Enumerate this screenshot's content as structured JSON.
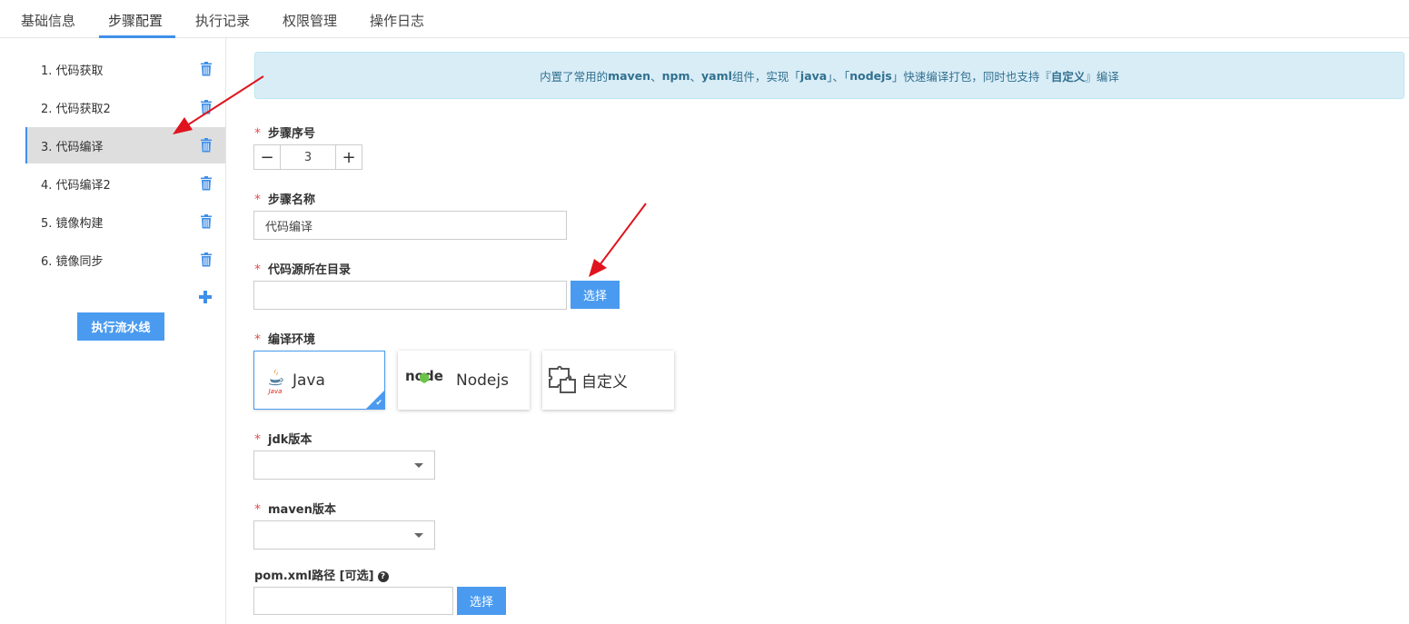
{
  "tabs": [
    {
      "label": "基础信息"
    },
    {
      "label": "步骤配置"
    },
    {
      "label": "执行记录"
    },
    {
      "label": "权限管理"
    },
    {
      "label": "操作日志"
    }
  ],
  "sidebar": {
    "steps": [
      {
        "label": "1. 代码获取"
      },
      {
        "label": "2. 代码获取2"
      },
      {
        "label": "3. 代码编译"
      },
      {
        "label": "4. 代码编译2"
      },
      {
        "label": "5. 镜像构建"
      },
      {
        "label": "6. 镜像同步"
      }
    ],
    "run_button": "执行流水线"
  },
  "notice": {
    "p1": "内置了常用的",
    "b1": "maven",
    "p2": "、",
    "b2": "npm",
    "p3": "、",
    "b3": "yaml",
    "p4": "组件，实现「",
    "b4": "java",
    "p5": "」、「",
    "b5": "nodejs",
    "p6": "」快速编译打包，同时也支持『",
    "b6": "自定义",
    "p7": "』编译"
  },
  "form": {
    "required_mark": "*",
    "step_no": {
      "label": "步骤序号",
      "value": "3",
      "minus": "−",
      "plus": "+"
    },
    "step_name": {
      "label": "步骤名称",
      "value": "代码编译"
    },
    "source_dir": {
      "label": "代码源所在目录",
      "value": "",
      "button": "选择"
    },
    "env": {
      "label": "编译环境",
      "options": [
        {
          "name": "Java",
          "logo_text": "Java"
        },
        {
          "name": "Nodejs",
          "logo_text": "node"
        },
        {
          "name": "自定义"
        }
      ],
      "selected": "Java"
    },
    "jdk": {
      "label": "jdk版本",
      "value": ""
    },
    "maven": {
      "label": "maven版本",
      "value": ""
    },
    "pom": {
      "label": "pom.xml路径 [可选]",
      "help": "?",
      "value": "",
      "button": "选择"
    }
  },
  "colors": {
    "accent": "#4a9bf0",
    "required": "#e94b4b",
    "arrow": "#e0141e",
    "notice_bg": "#d9edf7"
  }
}
